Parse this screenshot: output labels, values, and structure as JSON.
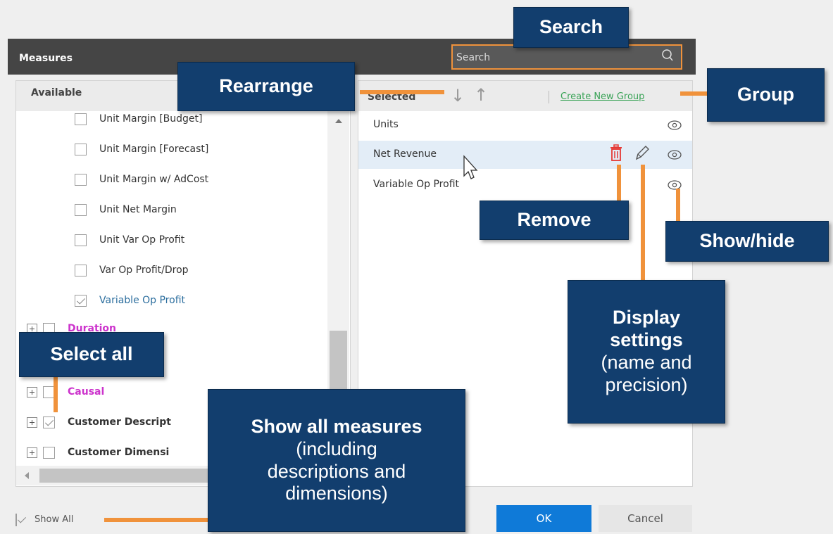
{
  "dialog": {
    "title": "Measures",
    "search_placeholder": "Search"
  },
  "available": {
    "header": "Available",
    "items": [
      {
        "label": "Unit Margin [Budget]",
        "checked": false
      },
      {
        "label": "Unit Margin [Forecast]",
        "checked": false
      },
      {
        "label": "Unit Margin w/ AdCost",
        "checked": false
      },
      {
        "label": "Unit Net Margin",
        "checked": false
      },
      {
        "label": "Unit Var Op Profit",
        "checked": false
      },
      {
        "label": "Var Op Profit/Drop",
        "checked": false
      },
      {
        "label": "Variable Op Profit",
        "checked": true
      }
    ],
    "groups": [
      {
        "label": "Duration",
        "color": "#cc33cc",
        "checked": false
      },
      {
        "label": "Causal",
        "color": "#cc33cc",
        "checked": false
      },
      {
        "label": "Customer Descript",
        "color": "#222222",
        "checked": true
      },
      {
        "label": "Customer Dimensi",
        "color": "#222222",
        "checked": false
      }
    ]
  },
  "selected": {
    "header": "Selected",
    "create_group": "Create New Group",
    "items": [
      "Units",
      "Net Revenue",
      "Variable Op Profit"
    ]
  },
  "footer": {
    "show_all": "Show All",
    "show_all_checked": true,
    "ok": "OK",
    "cancel": "Cancel"
  },
  "callouts": {
    "search": "Search",
    "rearrange": "Rearrange",
    "group": "Group",
    "remove": "Remove",
    "show_hide": "Show/hide",
    "display_settings_1": "Display",
    "display_settings_2": "settings",
    "display_settings_3": "(name and",
    "display_settings_4": "precision)",
    "select_all": "Select all",
    "show_all_1": "Show all measures",
    "show_all_2": "(including",
    "show_all_3": "descriptions and",
    "show_all_4": "dimensions)"
  },
  "colors": {
    "accent_orange": "#f0923b",
    "callout_blue": "#123e6e",
    "ok_blue": "#0f7ad8",
    "link_green": "#3aa357",
    "delete_red": "#e53935"
  },
  "icons": [
    "search-icon",
    "arrow-down-icon",
    "arrow-up-icon",
    "eye-icon",
    "trash-icon",
    "pencil-icon",
    "cursor-icon",
    "expand-icon",
    "checkbox-icon"
  ]
}
